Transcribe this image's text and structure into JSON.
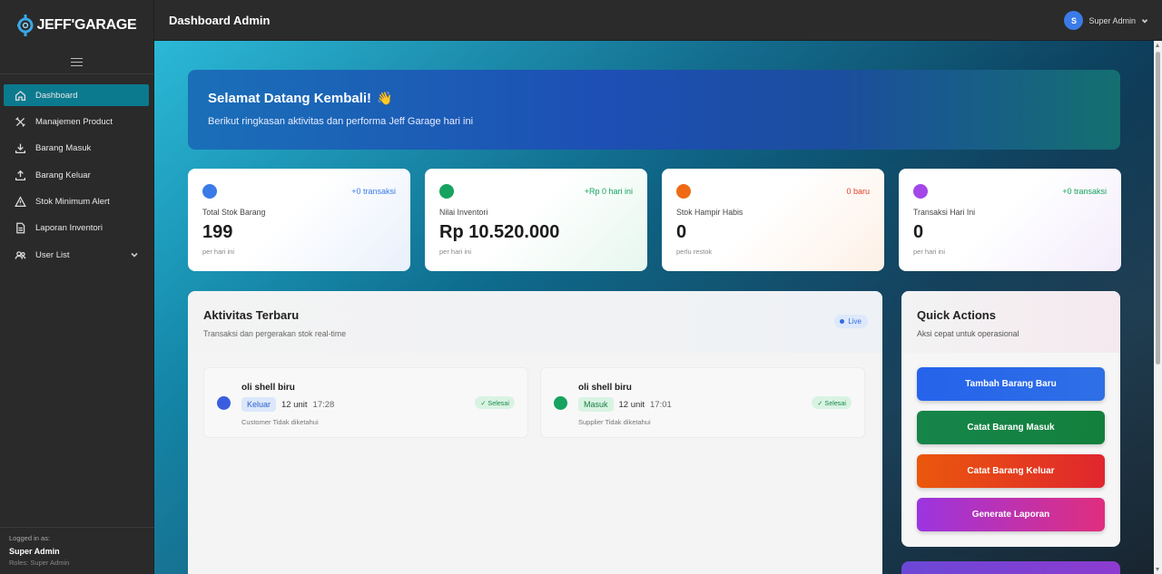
{
  "brand": {
    "name": "JEFF'GARAGE"
  },
  "sidebar": {
    "items": [
      {
        "label": "Dashboard",
        "icon": "home-icon",
        "active": true
      },
      {
        "label": "Manajemen Product",
        "icon": "tools-icon"
      },
      {
        "label": "Barang Masuk",
        "icon": "download-icon"
      },
      {
        "label": "Barang Keluar",
        "icon": "upload-icon"
      },
      {
        "label": "Stok Minimum Alert",
        "icon": "alert-triangle-icon"
      },
      {
        "label": "Laporan Inventori",
        "icon": "document-icon"
      },
      {
        "label": "User List",
        "icon": "users-icon",
        "expandable": true
      }
    ],
    "logged_in": {
      "label": "Logged in as:",
      "name": "Super Admin",
      "role": "Roles: Super Admin"
    }
  },
  "header": {
    "title": "Dashboard Admin",
    "user": {
      "initial": "S",
      "name": "Super Admin"
    }
  },
  "welcome": {
    "title": "Selamat Datang Kembali!",
    "emoji": "👋",
    "subtitle": "Berikut ringkasan aktivitas dan performa Jeff Garage hari ini"
  },
  "stats": [
    {
      "label": "Total Stok Barang",
      "value": "199",
      "delta": "+0 transaksi",
      "sub": "per hari ini",
      "color": "#3b7be8",
      "delta_color": "#3b7be8"
    },
    {
      "label": "Nilai Inventori",
      "value": "Rp 10.520.000",
      "delta": "+Rp 0 hari ini",
      "sub": "per hari ini",
      "color": "#16a35f",
      "delta_color": "#16a35f"
    },
    {
      "label": "Stok Hampir Habis",
      "value": "0",
      "delta": "0 baru",
      "sub": "perlu restok",
      "color": "#f06a16",
      "delta_color": "#e0402a"
    },
    {
      "label": "Transaksi Hari Ini",
      "value": "0",
      "delta": "+0 transaksi",
      "sub": "per hari ini",
      "color": "#a347e8",
      "delta_color": "#16a35f"
    }
  ],
  "activity": {
    "title": "Aktivitas Terbaru",
    "subtitle": "Transaksi dan pergerakan stok real-time",
    "live_label": "Live",
    "items": [
      {
        "name": "oli shell biru",
        "type": "Keluar",
        "qty": "12 unit",
        "time": "17:28",
        "party": "Customer Tidak diketahui",
        "status": "✓ Selesai",
        "color": "#3b5ee0"
      },
      {
        "name": "oli shell biru",
        "type": "Masuk",
        "qty": "12 unit",
        "time": "17:01",
        "party": "Supplier Tidak diketahui",
        "status": "✓ Selesai",
        "color": "#16a35f"
      }
    ]
  },
  "quick_actions": {
    "title": "Quick Actions",
    "subtitle": "Aksi cepat untuk operasional",
    "buttons": [
      {
        "label": "Tambah Barang Baru",
        "color": "#2563eb"
      },
      {
        "label": "Catat Barang Masuk",
        "color": "#15803d"
      },
      {
        "label": "Catat Barang Keluar",
        "color": "#e23b2a"
      },
      {
        "label": "Generate Laporan",
        "color": "#a93bd8"
      }
    ]
  }
}
